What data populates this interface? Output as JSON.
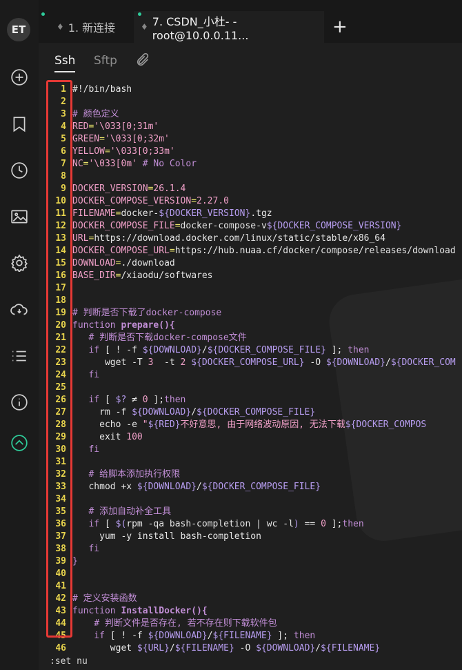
{
  "rail": {
    "logo_text": "ET",
    "icons": [
      "add-circle-icon",
      "bookmark-icon",
      "clock-icon",
      "image-icon",
      "gear-icon",
      "cloud-sync-icon",
      "list-icon",
      "info-icon",
      "chevron-up-circle-icon"
    ]
  },
  "tabs": [
    {
      "label": "1. 新连接"
    },
    {
      "label": "7. CSDN_小杜- - root@10.0.0.11..."
    }
  ],
  "new_tab": "+",
  "subtabs": {
    "ssh": "Ssh",
    "sftp": "Sftp"
  },
  "editor_lines": [
    {
      "n": "1",
      "segs": [
        [
          "wh",
          "#!/bin/bash"
        ]
      ]
    },
    {
      "n": "2",
      "segs": []
    },
    {
      "n": "3",
      "segs": [
        [
          "cm",
          "# 颜色定义"
        ]
      ]
    },
    {
      "n": "4",
      "segs": [
        [
          "var",
          "RED"
        ],
        [
          "op",
          "="
        ],
        [
          "str",
          "'\\033[0;31m'"
        ]
      ]
    },
    {
      "n": "5",
      "segs": [
        [
          "var",
          "GREEN"
        ],
        [
          "op",
          "="
        ],
        [
          "str",
          "'\\033[0;32m'"
        ]
      ]
    },
    {
      "n": "6",
      "segs": [
        [
          "var",
          "YELLOW"
        ],
        [
          "op",
          "="
        ],
        [
          "str",
          "'\\033[0;33m'"
        ]
      ]
    },
    {
      "n": "7",
      "segs": [
        [
          "var",
          "NC"
        ],
        [
          "op",
          "="
        ],
        [
          "str",
          "'\\033[0m'"
        ],
        [
          "wh",
          " "
        ],
        [
          "cm",
          "# No Color"
        ]
      ]
    },
    {
      "n": "8",
      "segs": []
    },
    {
      "n": "9",
      "segs": [
        [
          "var",
          "DOCKER_VERSION"
        ],
        [
          "op",
          "="
        ],
        [
          "num",
          "26.1.4"
        ]
      ]
    },
    {
      "n": "10",
      "segs": [
        [
          "var",
          "DOCKER_COMPOSE_VERSION"
        ],
        [
          "op",
          "="
        ],
        [
          "num",
          "2.27.0"
        ]
      ]
    },
    {
      "n": "11",
      "segs": [
        [
          "var",
          "FILENAME"
        ],
        [
          "op",
          "="
        ],
        [
          "wh",
          "docker-"
        ],
        [
          "sub",
          "${DOCKER_VERSION}"
        ],
        [
          "wh",
          ".tgz"
        ]
      ]
    },
    {
      "n": "12",
      "segs": [
        [
          "var",
          "DOCKER_COMPOSE_FILE"
        ],
        [
          "op",
          "="
        ],
        [
          "wh",
          "docker-compose-v"
        ],
        [
          "sub",
          "${DOCKER_COMPOSE_VERSION}"
        ]
      ]
    },
    {
      "n": "13",
      "segs": [
        [
          "var",
          "URL"
        ],
        [
          "op",
          "="
        ],
        [
          "wh",
          "https://download.docker.com/linux/static/stable/x86_64"
        ]
      ]
    },
    {
      "n": "14",
      "segs": [
        [
          "var",
          "DOCKER_COMPOSE_URL"
        ],
        [
          "op",
          "="
        ],
        [
          "wh",
          "https://hub.nuaa.cf/docker/compose/releases/download"
        ]
      ]
    },
    {
      "n": "15",
      "segs": [
        [
          "var",
          "DOWNLOAD"
        ],
        [
          "op",
          "="
        ],
        [
          "wh",
          "./download"
        ]
      ]
    },
    {
      "n": "16",
      "segs": [
        [
          "var",
          "BASE_DIR"
        ],
        [
          "op",
          "="
        ],
        [
          "wh",
          "/xiaodu/softwares"
        ]
      ]
    },
    {
      "n": "17",
      "segs": []
    },
    {
      "n": "18",
      "segs": []
    },
    {
      "n": "19",
      "segs": [
        [
          "cm",
          "# 判断是否下载了docker-compose"
        ]
      ]
    },
    {
      "n": "20",
      "segs": [
        [
          "kw",
          "function "
        ],
        [
          "fn",
          "prepare(){"
        ]
      ]
    },
    {
      "n": "21",
      "segs": [
        [
          "wh",
          "   "
        ],
        [
          "cm",
          "# 判断是否下载docker-compose文件"
        ]
      ]
    },
    {
      "n": "22",
      "segs": [
        [
          "wh",
          "   "
        ],
        [
          "kw",
          "if"
        ],
        [
          "wh",
          " [ ! -f "
        ],
        [
          "sub",
          "${DOWNLOAD}"
        ],
        [
          "wh",
          "/"
        ],
        [
          "sub",
          "${DOCKER_COMPOSE_FILE}"
        ],
        [
          "wh",
          " ]; "
        ],
        [
          "kw",
          "then"
        ]
      ]
    },
    {
      "n": "23",
      "segs": [
        [
          "wh",
          "      wget -T "
        ],
        [
          "num",
          "3"
        ],
        [
          "wh",
          "  -t "
        ],
        [
          "num",
          "2"
        ],
        [
          "wh",
          " "
        ],
        [
          "sub",
          "${DOCKER_COMPOSE_URL}"
        ],
        [
          "wh",
          " -O "
        ],
        [
          "sub",
          "${DOWNLOAD}"
        ],
        [
          "wh",
          "/"
        ],
        [
          "sub",
          "${DOCKER_COM"
        ]
      ]
    },
    {
      "n": "24",
      "segs": [
        [
          "wh",
          "   "
        ],
        [
          "kw",
          "fi"
        ]
      ]
    },
    {
      "n": "25",
      "segs": []
    },
    {
      "n": "26",
      "segs": [
        [
          "wh",
          "   "
        ],
        [
          "kw",
          "if"
        ],
        [
          "wh",
          " [ "
        ],
        [
          "sub",
          "$?"
        ],
        [
          "wh",
          " ≠ "
        ],
        [
          "num",
          "0"
        ],
        [
          "wh",
          " ];"
        ],
        [
          "kw",
          "then"
        ]
      ]
    },
    {
      "n": "27",
      "segs": [
        [
          "wh",
          "     rm -f "
        ],
        [
          "sub",
          "${DOWNLOAD}"
        ],
        [
          "wh",
          "/"
        ],
        [
          "sub",
          "${DOCKER_COMPOSE_FILE}"
        ]
      ]
    },
    {
      "n": "28",
      "segs": [
        [
          "wh",
          "     echo -e "
        ],
        [
          "str",
          "\""
        ],
        [
          "sub",
          "${RED}"
        ],
        [
          "str",
          "不好意思, 由于网络波动原因, 无法下载"
        ],
        [
          "sub",
          "${DOCKER_COMPOS"
        ]
      ]
    },
    {
      "n": "29",
      "segs": [
        [
          "wh",
          "     exit "
        ],
        [
          "num",
          "100"
        ]
      ]
    },
    {
      "n": "30",
      "segs": [
        [
          "wh",
          "   "
        ],
        [
          "kw",
          "fi"
        ]
      ]
    },
    {
      "n": "31",
      "segs": []
    },
    {
      "n": "32",
      "segs": [
        [
          "wh",
          "   "
        ],
        [
          "cm",
          "# 给脚本添加执行权限"
        ]
      ]
    },
    {
      "n": "33",
      "segs": [
        [
          "wh",
          "   chmod +x "
        ],
        [
          "sub",
          "${DOWNLOAD}"
        ],
        [
          "wh",
          "/"
        ],
        [
          "sub",
          "${DOCKER_COMPOSE_FILE}"
        ]
      ]
    },
    {
      "n": "34",
      "segs": []
    },
    {
      "n": "35",
      "segs": [
        [
          "wh",
          "   "
        ],
        [
          "cm",
          "# 添加自动补全工具"
        ]
      ]
    },
    {
      "n": "36",
      "segs": [
        [
          "wh",
          "   "
        ],
        [
          "kw",
          "if"
        ],
        [
          "wh",
          " [ "
        ],
        [
          "sub",
          "$("
        ],
        [
          "wh",
          "rpm -qa bash-completion | wc -l"
        ],
        [
          "sub",
          ")"
        ],
        [
          "wh",
          " == "
        ],
        [
          "num",
          "0"
        ],
        [
          "wh",
          " ];"
        ],
        [
          "kw",
          "then"
        ]
      ]
    },
    {
      "n": "37",
      "segs": [
        [
          "wh",
          "     yum -y install bash-completion"
        ]
      ]
    },
    {
      "n": "38",
      "segs": [
        [
          "wh",
          "   "
        ],
        [
          "kw",
          "fi"
        ]
      ]
    },
    {
      "n": "39",
      "segs": [
        [
          "kw",
          "}"
        ]
      ]
    },
    {
      "n": "40",
      "segs": []
    },
    {
      "n": "41",
      "segs": []
    },
    {
      "n": "42",
      "segs": [
        [
          "cm",
          "# 定义安装函数"
        ]
      ]
    },
    {
      "n": "43",
      "segs": [
        [
          "kw",
          "function "
        ],
        [
          "fn",
          "InstallDocker(){"
        ]
      ]
    },
    {
      "n": "44",
      "segs": [
        [
          "wh",
          "    "
        ],
        [
          "cm",
          "# 判断文件是否存在, 若不存在则下载软件包"
        ]
      ]
    },
    {
      "n": "45",
      "segs": [
        [
          "wh",
          "    "
        ],
        [
          "kw",
          "if"
        ],
        [
          "wh",
          " [ ! -f "
        ],
        [
          "sub",
          "${DOWNLOAD}"
        ],
        [
          "wh",
          "/"
        ],
        [
          "sub",
          "${FILENAME}"
        ],
        [
          "wh",
          " ]; "
        ],
        [
          "kw",
          "then"
        ]
      ]
    },
    {
      "n": "46",
      "segs": [
        [
          "wh",
          "       wget "
        ],
        [
          "sub",
          "${URL}"
        ],
        [
          "wh",
          "/"
        ],
        [
          "sub",
          "${FILENAME}"
        ],
        [
          "wh",
          " -O "
        ],
        [
          "sub",
          "${DOWNLOAD}"
        ],
        [
          "wh",
          "/"
        ],
        [
          "sub",
          "${FILENAME}"
        ]
      ]
    }
  ],
  "status_line": ":set nu",
  "colors": {
    "accent": "#2ecc9a",
    "highlight_box": "#e53935",
    "line_number": "#e8d44d"
  }
}
